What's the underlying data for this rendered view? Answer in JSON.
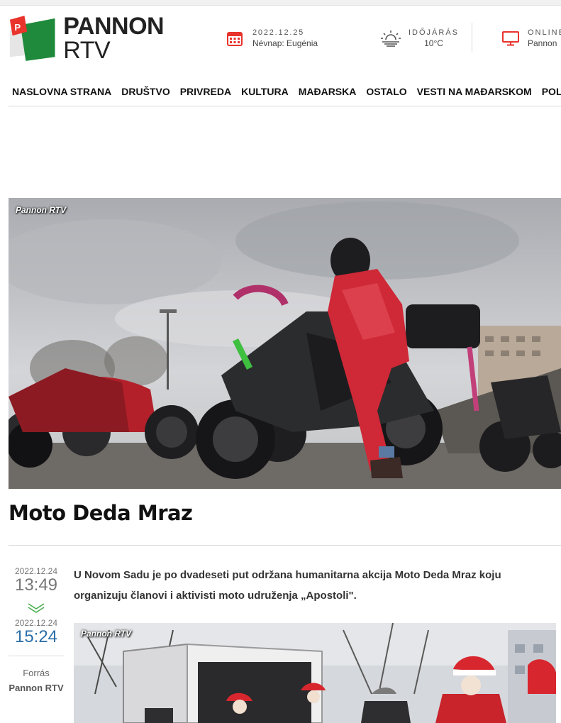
{
  "header": {
    "logo_text_main": "PANNON",
    "logo_text_rtv": "RTV",
    "date": "2022.12.25",
    "nevnap": "Névnap: Eugénia",
    "weather_label": "IDŐJÁRÁS",
    "weather_temp": "10°C",
    "online_label": "ONLINE",
    "online_value": "Pannon"
  },
  "nav": {
    "items": [
      {
        "label": "NASLOVNA STRANA"
      },
      {
        "label": "DRUŠTVO"
      },
      {
        "label": "PRIVREDA"
      },
      {
        "label": "KULTURA"
      },
      {
        "label": "MAĐARSKA"
      },
      {
        "label": "OSTALO"
      },
      {
        "label": "VESTI NA MAĐARSKOM"
      },
      {
        "label": "POLITIKA"
      }
    ]
  },
  "hero": {
    "watermark": "Pannon RTV"
  },
  "article": {
    "title": "Moto Deda Mraz",
    "published_date": "2022.12.24",
    "published_time": "13:49",
    "updated_date": "2022.12.24",
    "updated_time": "15:24",
    "source_label": "Forrás",
    "source": "Pannon RTV",
    "lead": "U Novom Sadu je po dvadeseti put održana humanitarna akcija Moto Deda Mraz koju organizuju članovi i aktivisti moto udruženja „Apostoli\".",
    "photo_watermark": "Pannon RTV"
  },
  "colors": {
    "logo_red": "#e8342c",
    "logo_green": "#1f8a3b",
    "icon_red": "#e8342c",
    "chevron_green": "#4caf50",
    "updated_time_blue": "#2b6ea8"
  }
}
